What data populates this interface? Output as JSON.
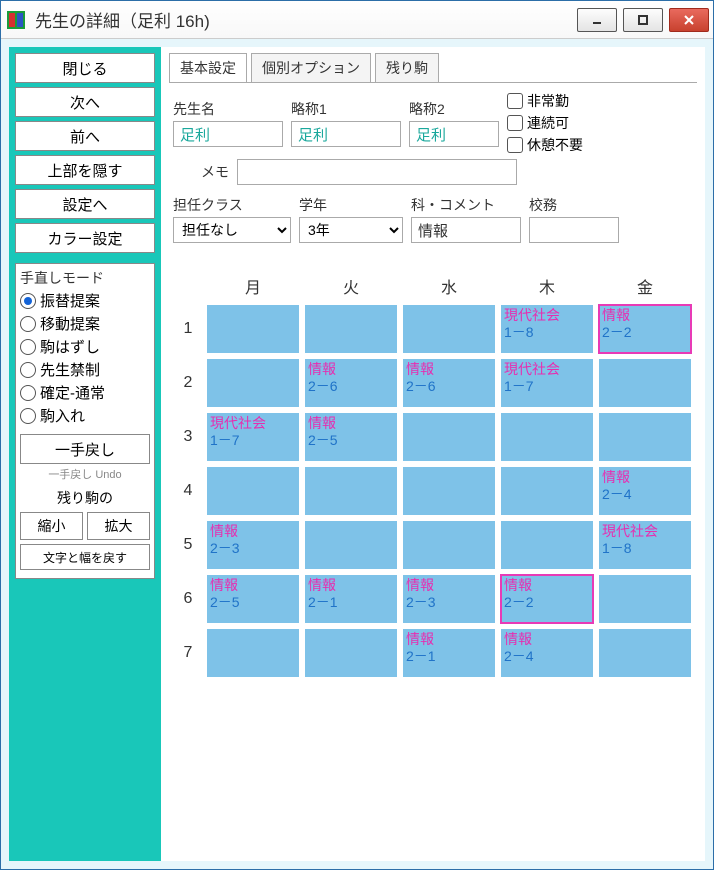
{
  "window": {
    "title": "先生の詳細（足利 16h)"
  },
  "sidebar": {
    "buttons": [
      "閉じる",
      "次へ",
      "前へ",
      "上部を隠す",
      "設定へ",
      "カラー設定"
    ],
    "handmode_title": "手直しモード",
    "modes": [
      "振替提案",
      "移動提案",
      "駒はずし",
      "先生禁制",
      "確定-通常",
      "駒入れ"
    ],
    "mode_selected": 0,
    "undo": "一手戻し",
    "undo_hint": "一手戻し Undo",
    "koma_title": "残り駒の",
    "zoom_out": "縮小",
    "zoom_in": "拡大",
    "reset": "文字と幅を戻す"
  },
  "tabs": [
    "基本設定",
    "個別オプション",
    "残り駒"
  ],
  "tab_active": 0,
  "form": {
    "name_lbl": "先生名",
    "name": "足利",
    "abbr1_lbl": "略称1",
    "abbr1": "足利",
    "abbr2_lbl": "略称2",
    "abbr2": "足利",
    "memo_lbl": "メモ",
    "memo": "",
    "cb1": "非常勤",
    "cb2": "連続可",
    "cb3": "休憩不要",
    "class_lbl": "担任クラス",
    "class": "担任なし",
    "grade_lbl": "学年",
    "grade": "3年",
    "subject_lbl": "科・コメント",
    "subject": "情報",
    "duty_lbl": "校務",
    "duty": ""
  },
  "grid": {
    "days": [
      "月",
      "火",
      "水",
      "木",
      "金"
    ],
    "periods": [
      "1",
      "2",
      "3",
      "4",
      "5",
      "6",
      "7"
    ],
    "cells": [
      [
        null,
        null,
        null,
        {
          "s": "現代社会",
          "c": "1－8"
        },
        {
          "s": "情報",
          "c": "2－2",
          "o": true
        }
      ],
      [
        null,
        {
          "s": "情報",
          "c": "2－6"
        },
        {
          "s": "情報",
          "c": "2－6"
        },
        {
          "s": "現代社会",
          "c": "1－7"
        },
        null
      ],
      [
        {
          "s": "現代社会",
          "c": "1－7"
        },
        {
          "s": "情報",
          "c": "2－5"
        },
        null,
        null,
        null
      ],
      [
        null,
        null,
        null,
        null,
        {
          "s": "情報",
          "c": "2－4"
        }
      ],
      [
        {
          "s": "情報",
          "c": "2－3"
        },
        null,
        null,
        null,
        {
          "s": "現代社会",
          "c": "1－8"
        }
      ],
      [
        {
          "s": "情報",
          "c": "2－5"
        },
        {
          "s": "情報",
          "c": "2－1"
        },
        {
          "s": "情報",
          "c": "2－3"
        },
        {
          "s": "情報",
          "c": "2－2",
          "o": true
        },
        null
      ],
      [
        null,
        null,
        {
          "s": "情報",
          "c": "2－1"
        },
        {
          "s": "情報",
          "c": "2－4"
        },
        null
      ]
    ]
  }
}
